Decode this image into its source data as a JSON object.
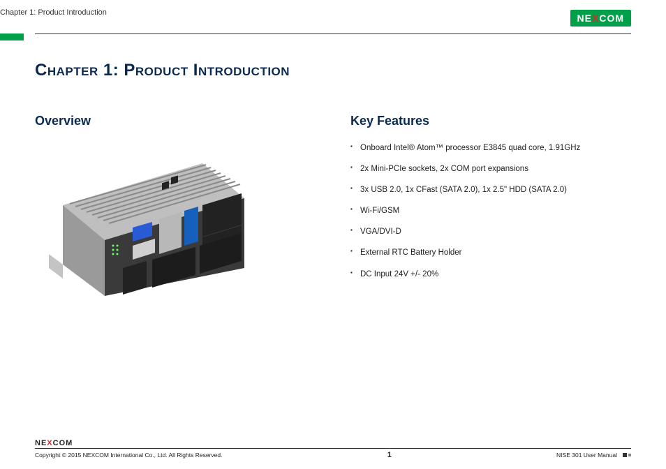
{
  "header": {
    "breadcrumb": "Chapter 1: Product Introduction",
    "logo_pre": "NE",
    "logo_x": "X",
    "logo_post": "COM"
  },
  "chapter_title": "Chapter 1: Product Introduction",
  "overview": {
    "heading": "Overview"
  },
  "key_features": {
    "heading": "Key Features",
    "items": [
      "Onboard Intel® Atom™ processor E3845 quad core, 1.91GHz",
      "2x Mini-PCIe sockets, 2x COM port expansions",
      "3x USB 2.0, 1x CFast (SATA 2.0), 1x 2.5\" HDD (SATA 2.0)",
      "Wi-Fi/GSM",
      "VGA/DVI-D",
      "External RTC Battery Holder",
      "DC Input 24V +/- 20%"
    ]
  },
  "footer": {
    "logo_pre": "NE",
    "logo_x": "X",
    "logo_post": "COM",
    "copyright": "Copyright © 2015 NEXCOM International Co., Ltd. All Rights Reserved.",
    "page_number": "1",
    "doc_title": "NISE 301 User Manual"
  }
}
